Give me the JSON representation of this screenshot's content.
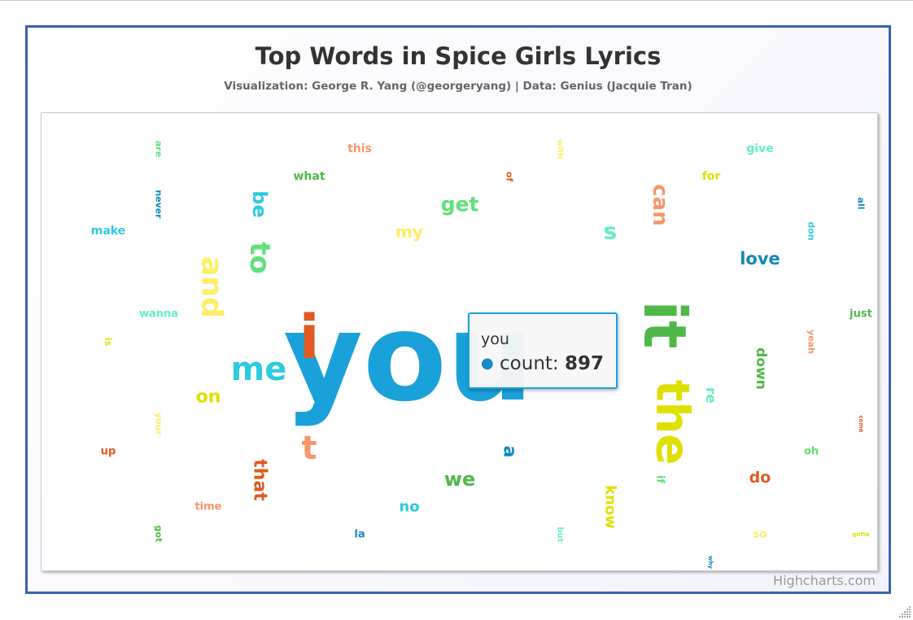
{
  "header": {
    "title": "Top Words in Spice Girls Lyrics",
    "subtitle": "Visualization: George R. Yang (@georgeryang) | Data: Genius (Jacquie Tran)"
  },
  "credits": "Highcharts.com",
  "tooltip": {
    "word": "you",
    "label": "count:",
    "value": "897",
    "dot": "●",
    "dot_color": "#1889c9"
  },
  "chart_data": {
    "type": "wordcloud",
    "title": "Top Words in Spice Girls Lyrics",
    "subtitle": "Visualization: George R. Yang (@georgeryang) | Data: Genius (Jacquie Tran)",
    "value_label": "count",
    "words": [
      {
        "name": "you",
        "count": 897
      },
      {
        "name": "it"
      },
      {
        "name": "the"
      },
      {
        "name": "i"
      },
      {
        "name": "me"
      },
      {
        "name": "and"
      },
      {
        "name": "to"
      },
      {
        "name": "be"
      },
      {
        "name": "can"
      },
      {
        "name": "get"
      },
      {
        "name": "s"
      },
      {
        "name": "t"
      },
      {
        "name": "that"
      },
      {
        "name": "we"
      },
      {
        "name": "know"
      },
      {
        "name": "on"
      },
      {
        "name": "love"
      },
      {
        "name": "down"
      },
      {
        "name": "my"
      },
      {
        "name": "do"
      },
      {
        "name": "no"
      },
      {
        "name": "a"
      },
      {
        "name": "re"
      },
      {
        "name": "make"
      },
      {
        "name": "this"
      },
      {
        "name": "what"
      },
      {
        "name": "give"
      },
      {
        "name": "for"
      },
      {
        "name": "wanna"
      },
      {
        "name": "just"
      },
      {
        "name": "oh"
      },
      {
        "name": "time"
      },
      {
        "name": "up"
      },
      {
        "name": "la"
      },
      {
        "name": "so"
      },
      {
        "name": "if"
      },
      {
        "name": "yeah"
      },
      {
        "name": "don"
      },
      {
        "name": "all"
      },
      {
        "name": "your"
      },
      {
        "name": "never"
      },
      {
        "name": "are"
      },
      {
        "name": "with"
      },
      {
        "name": "of"
      },
      {
        "name": "is"
      },
      {
        "name": "got"
      },
      {
        "name": "but"
      },
      {
        "name": "come"
      },
      {
        "name": "gotta"
      },
      {
        "name": "why"
      }
    ],
    "palette": [
      "#1aa1d9",
      "#2ecae0",
      "#62e07a",
      "#4fb848",
      "#e0e000",
      "#ffed64",
      "#f9956a",
      "#e05a22",
      "#1489bd",
      "#63f0c0"
    ]
  }
}
